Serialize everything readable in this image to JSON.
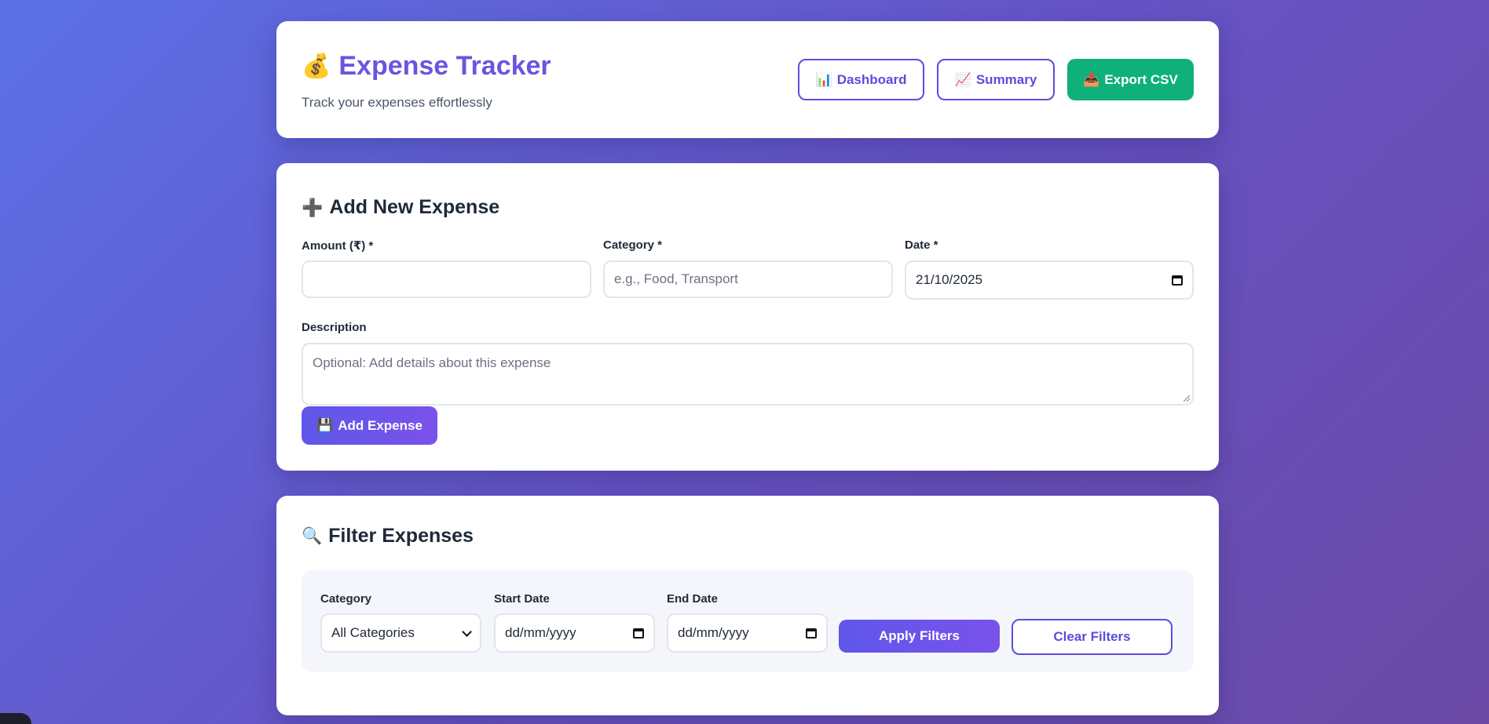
{
  "header": {
    "icon": "money-bag-icon",
    "icon_glyph": "💰",
    "title": "Expense Tracker",
    "subtitle": "Track your expenses effortlessly",
    "buttons": {
      "dashboard": {
        "icon_glyph": "📊",
        "label": "Dashboard"
      },
      "summary": {
        "icon_glyph": "📈",
        "label": "Summary"
      },
      "export": {
        "icon_glyph": "📤",
        "label": "Export CSV"
      }
    }
  },
  "add_expense": {
    "icon_glyph": "➕",
    "title": "Add New Expense",
    "amount": {
      "label": "Amount (₹) *",
      "value": "",
      "placeholder": ""
    },
    "category": {
      "label": "Category *",
      "value": "",
      "placeholder": "e.g., Food, Transport"
    },
    "date": {
      "label": "Date *",
      "value": "21/10/2025"
    },
    "description": {
      "label": "Description",
      "value": "",
      "placeholder": "Optional: Add details about this expense"
    },
    "submit": {
      "icon_glyph": "💾",
      "label": "Add Expense"
    }
  },
  "filter": {
    "icon_glyph": "🔍",
    "title": "Filter Expenses",
    "category": {
      "label": "Category",
      "selected": "All Categories"
    },
    "start_date": {
      "label": "Start Date",
      "value": "dd/mm/yyyy"
    },
    "end_date": {
      "label": "End Date",
      "value": "dd/mm/yyyy"
    },
    "apply": {
      "label": "Apply Filters"
    },
    "clear": {
      "label": "Clear Filters"
    }
  },
  "colors": {
    "accent": "#6a55e0",
    "primary_button": "#5f57ea",
    "export_button": "#10b07a",
    "outline": "#5a4ddb"
  }
}
